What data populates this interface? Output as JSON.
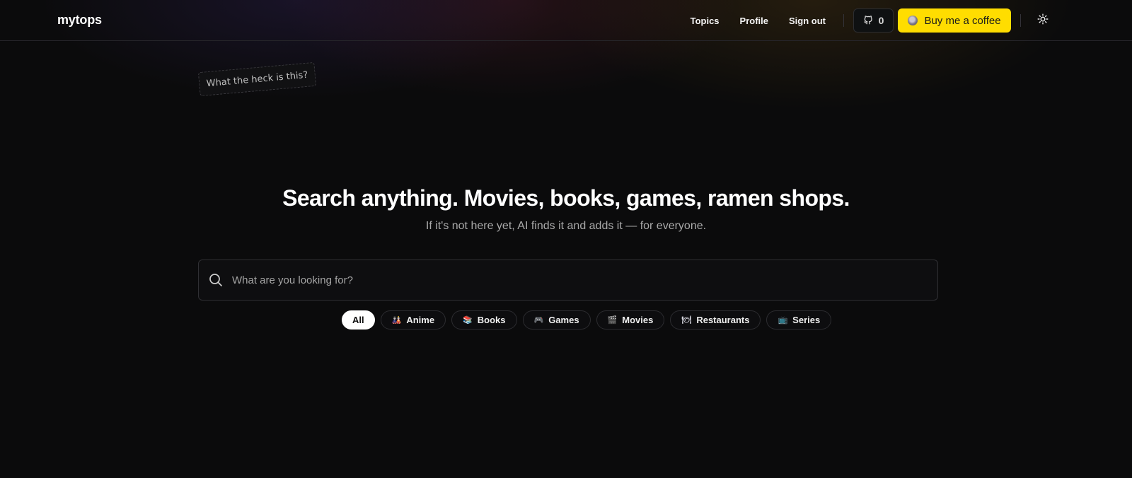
{
  "header": {
    "logo": "mytops",
    "nav": [
      {
        "label": "Topics"
      },
      {
        "label": "Profile"
      },
      {
        "label": "Sign out"
      }
    ],
    "github_count": "0",
    "coffee_label": "Buy me a coffee"
  },
  "sticker": {
    "text": "What the heck is this?"
  },
  "hero": {
    "title": "Search anything. Movies, books, games, ramen shops.",
    "subtitle": "If it's not here yet, AI finds it and adds it — for everyone."
  },
  "search": {
    "placeholder": "What are you looking for?",
    "value": ""
  },
  "filters": [
    {
      "label": "All",
      "icon": "",
      "active": true
    },
    {
      "label": "Anime",
      "icon": "🎎",
      "color": "#e86a8f"
    },
    {
      "label": "Books",
      "icon": "📚",
      "color": "#6fb1e8"
    },
    {
      "label": "Games",
      "icon": "🎮",
      "color": "#8e78e0"
    },
    {
      "label": "Movies",
      "icon": "🎬",
      "color": "#9a8fc9"
    },
    {
      "label": "Restaurants",
      "icon": "🍽",
      "color": "#cfcfd8"
    },
    {
      "label": "Series",
      "icon": "📺",
      "color": "#5ab0d8"
    }
  ],
  "colors": {
    "background": "#0b0b0c",
    "coffee_yellow": "#ffdd00",
    "text": "#f2f2f2",
    "muted": "#a9a9a9"
  }
}
